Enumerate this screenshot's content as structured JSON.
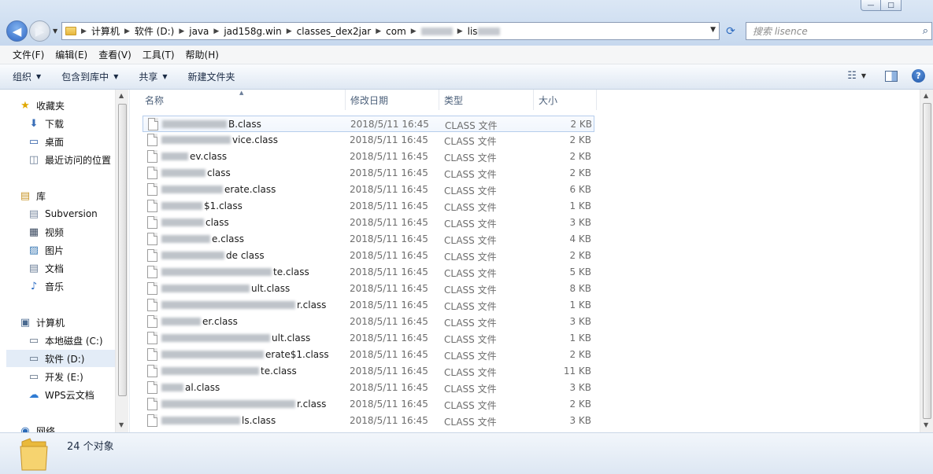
{
  "titlebar": {
    "window_buttons": [
      "—",
      "□"
    ],
    "back_glyph": "◀",
    "forward_glyph": "▶",
    "recent_glyph": "▼"
  },
  "address": {
    "breadcrumbs": [
      "计算机",
      "软件 (D:)",
      "java",
      "jad158g.win",
      "classes_dex2jar",
      "com"
    ],
    "tail_visible": "lis",
    "sep_glyph": "▶",
    "dropdown_glyph": "▼",
    "refresh_glyph": "⟳"
  },
  "search": {
    "placeholder": "搜索 lisence",
    "icon_glyph": "⌕"
  },
  "menu": [
    "文件(F)",
    "编辑(E)",
    "查看(V)",
    "工具(T)",
    "帮助(H)"
  ],
  "commands": {
    "organize": "组织",
    "include_in_library": "包含到库中",
    "share": "共享",
    "new_folder": "新建文件夹",
    "dropdown_glyph": "▼",
    "view_glyph": "☷",
    "help_glyph": "?"
  },
  "nav": {
    "favorites": {
      "label": "收藏夹",
      "icon_glyph": "★",
      "items": [
        "下载",
        "桌面",
        "最近访问的位置"
      ]
    },
    "libraries": {
      "label": "库",
      "items": [
        "Subversion",
        "视频",
        "图片",
        "文档",
        "音乐"
      ]
    },
    "computer": {
      "label": "计算机",
      "items": [
        "本地磁盘 (C:)",
        "软件 (D:)",
        "开发 (E:)",
        "WPS云文档"
      ]
    },
    "network": {
      "label": "网络"
    },
    "item_glyphs": {
      "downloads": "⬇",
      "desktop": "▭",
      "recent": "◫",
      "library": "▤",
      "svn": "▤",
      "video": "▦",
      "pictures": "▨",
      "docs": "▤",
      "music": "♪",
      "computer": "▣",
      "drive": "▭",
      "cloud": "☁",
      "network": "◉"
    },
    "scroll_up_glyph": "▲",
    "scroll_down_glyph": "▼"
  },
  "columns": {
    "name": "名称",
    "date": "修改日期",
    "type": "类型",
    "size": "大小",
    "sort_glyph": "▲"
  },
  "files": [
    {
      "name": "B.class",
      "date": "2018/5/11 16:45",
      "type": "CLASS 文件",
      "size": "2 KB"
    },
    {
      "name": "vice.class",
      "date": "2018/5/11 16:45",
      "type": "CLASS 文件",
      "size": "2 KB"
    },
    {
      "name": "ev.class",
      "date": "2018/5/11 16:45",
      "type": "CLASS 文件",
      "size": "2 KB"
    },
    {
      "name": "class",
      "date": "2018/5/11 16:45",
      "type": "CLASS 文件",
      "size": "2 KB"
    },
    {
      "name": "erate.class",
      "date": "2018/5/11 16:45",
      "type": "CLASS 文件",
      "size": "6 KB"
    },
    {
      "name": "$1.class",
      "date": "2018/5/11 16:45",
      "type": "CLASS 文件",
      "size": "1 KB"
    },
    {
      "name": "class",
      "date": "2018/5/11 16:45",
      "type": "CLASS 文件",
      "size": "3 KB"
    },
    {
      "name": "e.class",
      "date": "2018/5/11 16:45",
      "type": "CLASS 文件",
      "size": "4 KB"
    },
    {
      "name": "de class",
      "date": "2018/5/11 16:45",
      "type": "CLASS 文件",
      "size": "2 KB"
    },
    {
      "name": "te.class",
      "date": "2018/5/11 16:45",
      "type": "CLASS 文件",
      "size": "5 KB"
    },
    {
      "name": "ult.class",
      "date": "2018/5/11 16:45",
      "type": "CLASS 文件",
      "size": "8 KB"
    },
    {
      "name": "r.class",
      "date": "2018/5/11 16:45",
      "type": "CLASS 文件",
      "size": "1 KB"
    },
    {
      "name": "er.class",
      "date": "2018/5/11 16:45",
      "type": "CLASS 文件",
      "size": "3 KB"
    },
    {
      "name": "ult.class",
      "date": "2018/5/11 16:45",
      "type": "CLASS 文件",
      "size": "1 KB"
    },
    {
      "name": "erate$1.class",
      "date": "2018/5/11 16:45",
      "type": "CLASS 文件",
      "size": "2 KB"
    },
    {
      "name": "te.class",
      "date": "2018/5/11 16:45",
      "type": "CLASS 文件",
      "size": "11 KB"
    },
    {
      "name": "al.class",
      "date": "2018/5/11 16:45",
      "type": "CLASS 文件",
      "size": "3 KB"
    },
    {
      "name": "r.class",
      "date": "2018/5/11 16:45",
      "type": "CLASS 文件",
      "size": "2 KB"
    },
    {
      "name": "ls.class",
      "date": "2018/5/11 16:45",
      "type": "CLASS 文件",
      "size": "3 KB"
    }
  ],
  "status": {
    "count": "24 个对象"
  }
}
